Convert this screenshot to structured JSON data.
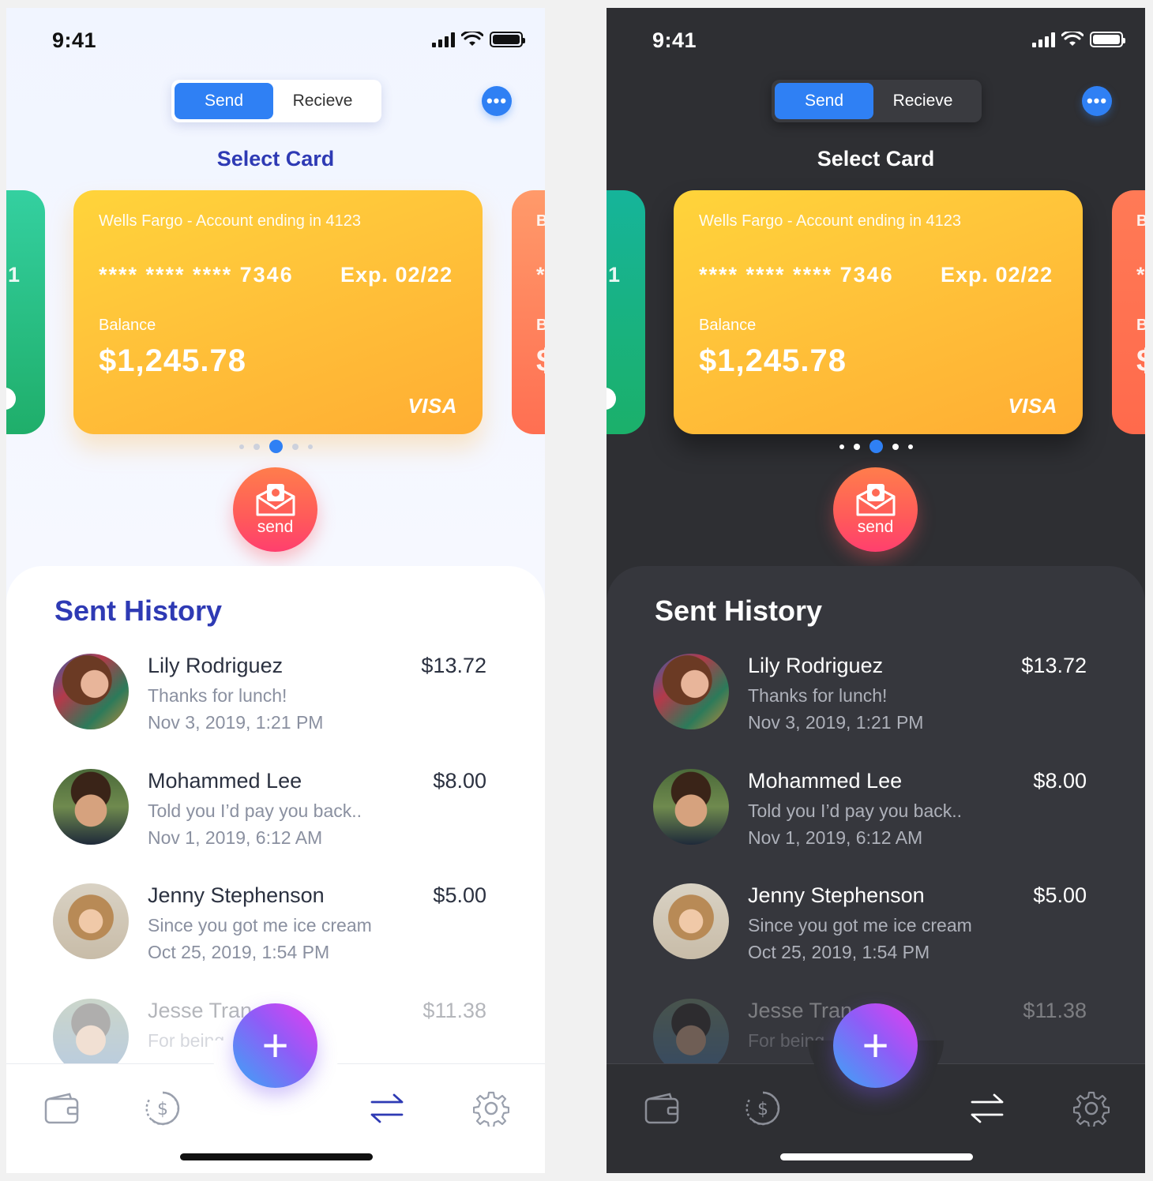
{
  "status": {
    "time": "9:41"
  },
  "toggle": {
    "send_label": "Send",
    "receive_label": "Recieve"
  },
  "more_button": {
    "label": "•••"
  },
  "select_card_title": "Select Card",
  "side_cards": {
    "left_fragment": "1",
    "right_fragments": [
      "B",
      "*",
      "B",
      "$"
    ]
  },
  "card": {
    "bank": "Wells Fargo - Account ending in 4123",
    "number": "****  ****  ****  7346",
    "expiry": "Exp. 02/22",
    "balance_label": "Balance",
    "balance": "$1,245.78",
    "network": "VISA"
  },
  "carousel": {
    "total": 5,
    "active_index": 2
  },
  "send_button": {
    "label": "send"
  },
  "history": {
    "title": "Sent History",
    "items": [
      {
        "name": "Lily Rodriguez",
        "memo": "Thanks for lunch!",
        "date": "Nov 3, 2019, 1:21 PM",
        "amount": "$13.72"
      },
      {
        "name": "Mohammed Lee",
        "memo": "Told you I’d pay you back..",
        "date": "Nov 1, 2019, 6:12 AM",
        "amount": "$8.00"
      },
      {
        "name": "Jenny Stephenson",
        "memo": "Since you got me ice cream",
        "date": "Oct 25, 2019, 1:54 PM",
        "amount": "$5.00"
      },
      {
        "name": "Jesse Tran",
        "memo": "For being",
        "date": "",
        "amount": "$11.38"
      }
    ]
  },
  "fab": {
    "label": "+"
  },
  "tabbar": {
    "icons": [
      "wallet-icon",
      "history-dollar-icon",
      "transfer-icon",
      "settings-icon"
    ],
    "active": "transfer-icon"
  },
  "colors": {
    "accent": "#2f80f4",
    "title_light": "#2e3ab4",
    "card_yellow": "#ffc43a",
    "send_orange": "#ff5a5a",
    "dark_bg": "#2e2f33"
  }
}
